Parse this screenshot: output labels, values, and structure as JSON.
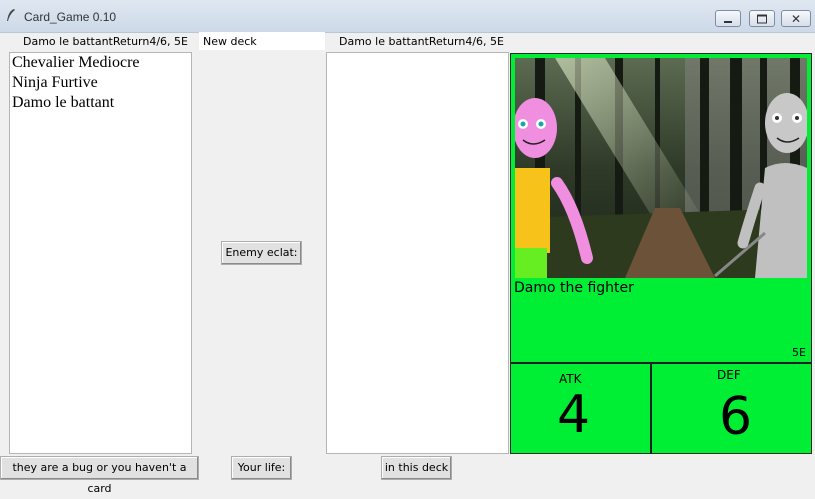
{
  "window": {
    "title": "Card_Game 0.10"
  },
  "top": {
    "left_label": "Damo le battantReturn4/6, 5E",
    "deck_entry_value": "New deck",
    "right_label": "Damo le battantReturn4/6, 5E"
  },
  "deck_list": [
    "Chevalier Mediocre",
    "Ninja Furtive",
    "Damo le battant"
  ],
  "buttons": {
    "enemy_eclat": "Enemy eclat:",
    "bug": "they are a bug or you haven't a card",
    "your_life": "Your life:",
    "in_deck": "in this deck"
  },
  "card": {
    "name": "Damo the fighter",
    "cost": "5E",
    "atk_label": "ATK",
    "def_label": "DEF",
    "atk": "4",
    "def": "6",
    "bg_color": "#00ee33"
  }
}
